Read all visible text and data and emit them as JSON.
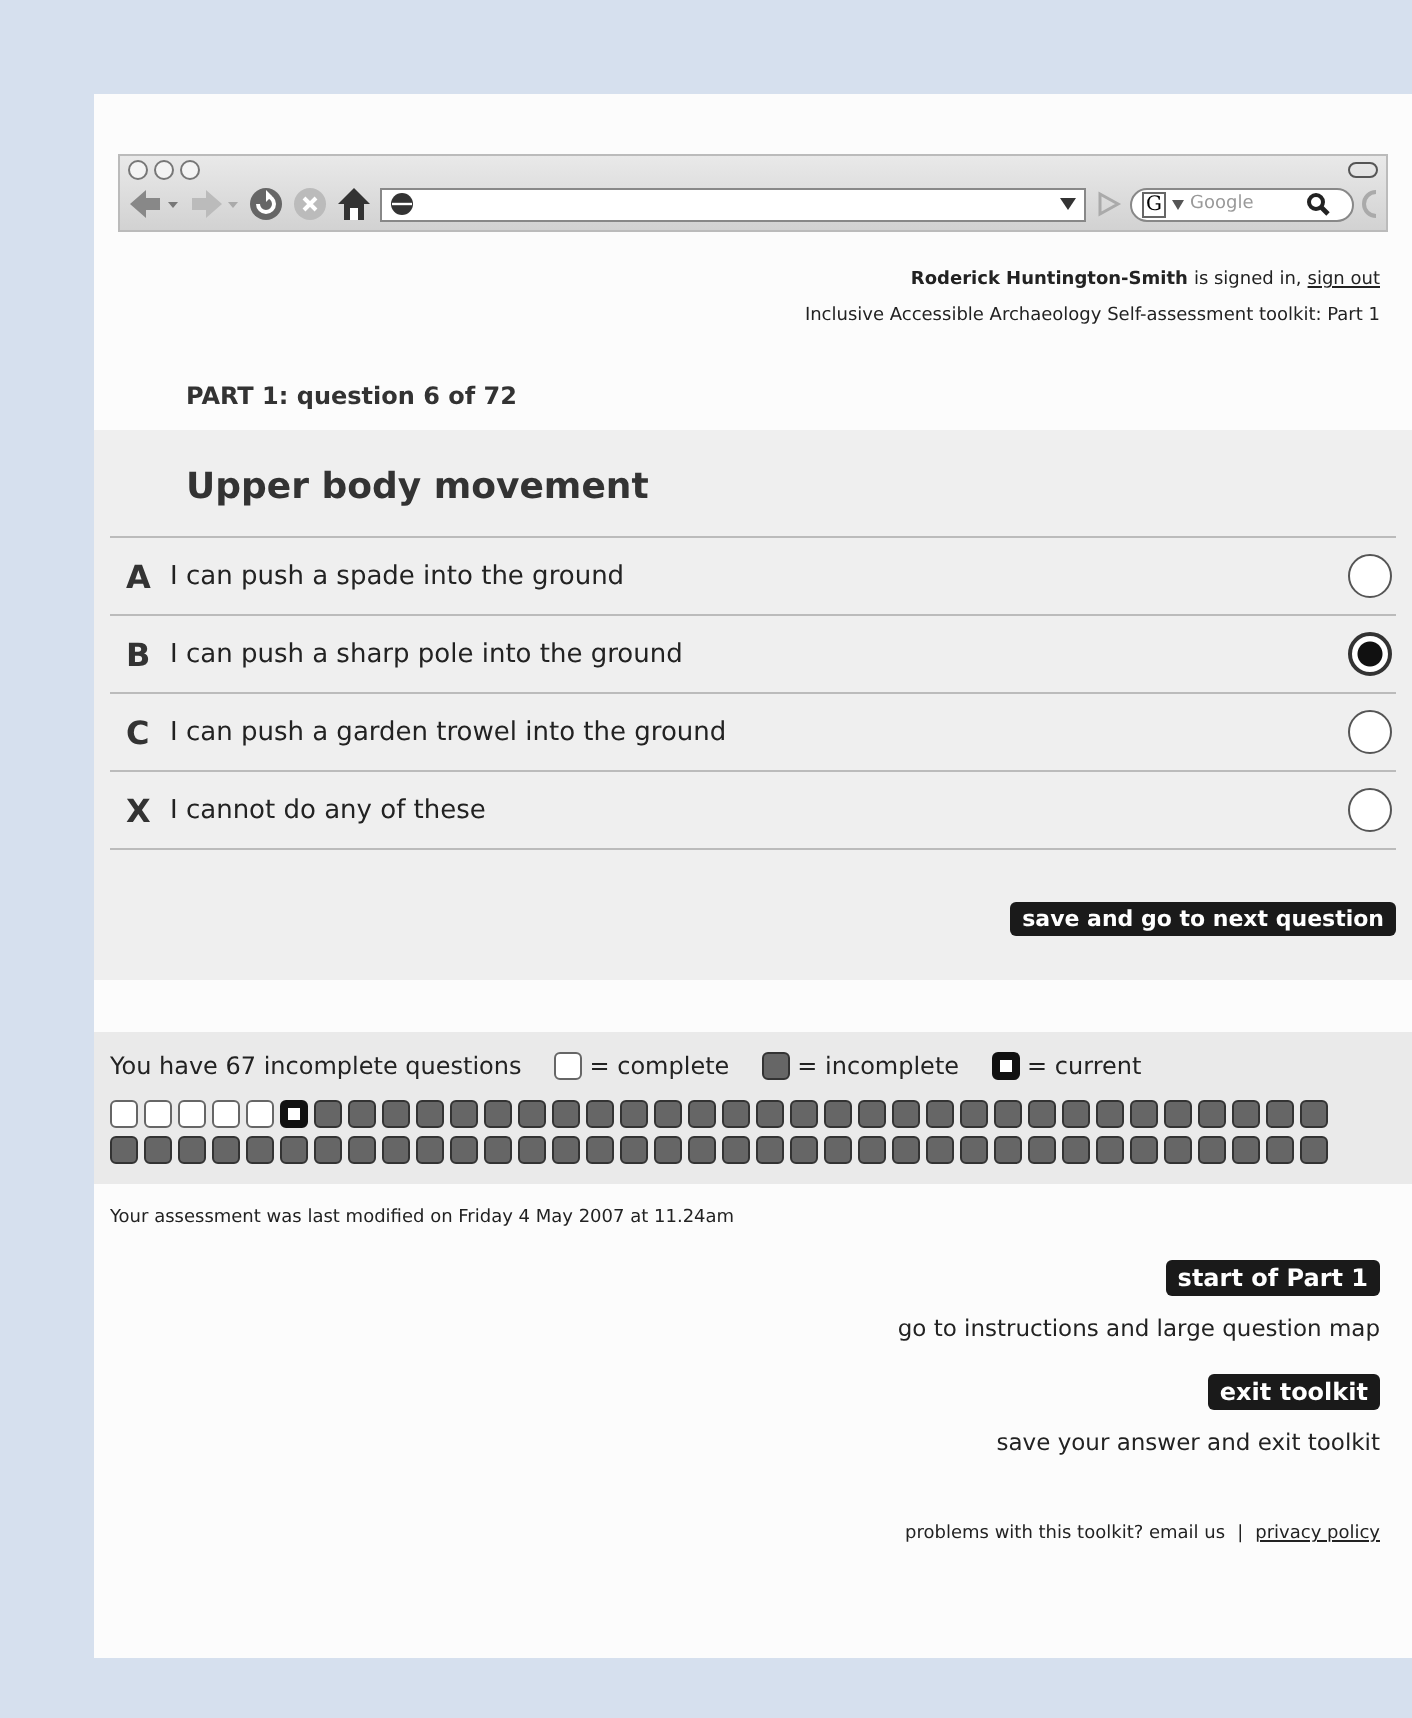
{
  "browser": {
    "search": {
      "engine": "G",
      "placeholder": "Google"
    }
  },
  "header": {
    "user": "Roderick Huntington-Smith",
    "signed_in_text": "is signed in,",
    "sign_out": "sign out",
    "toolkit_title": "Inclusive Accessible Archaeology Self-assessment toolkit: Part 1"
  },
  "progress": "PART 1: question 6 of 72",
  "question": {
    "title": "Upper body movement",
    "options": [
      {
        "letter": "A",
        "text": "I can push a spade into the ground",
        "selected": false
      },
      {
        "letter": "B",
        "text": "I can push a sharp pole into the ground",
        "selected": true
      },
      {
        "letter": "C",
        "text": "I can push a garden trowel into the ground",
        "selected": false
      },
      {
        "letter": "X",
        "text": "I cannot do any of these",
        "selected": false
      }
    ],
    "next_button": "save and go to next question"
  },
  "map": {
    "summary": "You have 67 incomplete questions",
    "legend": [
      {
        "kind": "complete",
        "label": "= complete"
      },
      {
        "kind": "incomplete",
        "label": "= incomplete"
      },
      {
        "kind": "current",
        "label": "= current"
      }
    ],
    "questions": [
      {
        "kind": "complete"
      },
      {
        "kind": "complete"
      },
      {
        "kind": "complete"
      },
      {
        "kind": "complete"
      },
      {
        "kind": "complete"
      },
      {
        "kind": "current"
      },
      {
        "kind": "incomplete"
      },
      {
        "kind": "incomplete"
      },
      {
        "kind": "incomplete"
      },
      {
        "kind": "incomplete"
      },
      {
        "kind": "incomplete"
      },
      {
        "kind": "incomplete"
      },
      {
        "kind": "incomplete"
      },
      {
        "kind": "incomplete"
      },
      {
        "kind": "incomplete"
      },
      {
        "kind": "incomplete"
      },
      {
        "kind": "incomplete"
      },
      {
        "kind": "incomplete"
      },
      {
        "kind": "incomplete"
      },
      {
        "kind": "incomplete"
      },
      {
        "kind": "incomplete"
      },
      {
        "kind": "incomplete"
      },
      {
        "kind": "incomplete"
      },
      {
        "kind": "incomplete"
      },
      {
        "kind": "incomplete"
      },
      {
        "kind": "incomplete"
      },
      {
        "kind": "incomplete"
      },
      {
        "kind": "incomplete"
      },
      {
        "kind": "incomplete"
      },
      {
        "kind": "incomplete"
      },
      {
        "kind": "incomplete"
      },
      {
        "kind": "incomplete"
      },
      {
        "kind": "incomplete"
      },
      {
        "kind": "incomplete"
      },
      {
        "kind": "incomplete"
      },
      {
        "kind": "incomplete"
      },
      {
        "kind": "incomplete"
      },
      {
        "kind": "incomplete"
      },
      {
        "kind": "incomplete"
      },
      {
        "kind": "incomplete"
      },
      {
        "kind": "incomplete"
      },
      {
        "kind": "incomplete"
      },
      {
        "kind": "incomplete"
      },
      {
        "kind": "incomplete"
      },
      {
        "kind": "incomplete"
      },
      {
        "kind": "incomplete"
      },
      {
        "kind": "incomplete"
      },
      {
        "kind": "incomplete"
      },
      {
        "kind": "incomplete"
      },
      {
        "kind": "incomplete"
      },
      {
        "kind": "incomplete"
      },
      {
        "kind": "incomplete"
      },
      {
        "kind": "incomplete"
      },
      {
        "kind": "incomplete"
      },
      {
        "kind": "incomplete"
      },
      {
        "kind": "incomplete"
      },
      {
        "kind": "incomplete"
      },
      {
        "kind": "incomplete"
      },
      {
        "kind": "incomplete"
      },
      {
        "kind": "incomplete"
      },
      {
        "kind": "incomplete"
      },
      {
        "kind": "incomplete"
      },
      {
        "kind": "incomplete"
      },
      {
        "kind": "incomplete"
      },
      {
        "kind": "incomplete"
      },
      {
        "kind": "incomplete"
      },
      {
        "kind": "incomplete"
      },
      {
        "kind": "incomplete"
      },
      {
        "kind": "incomplete"
      },
      {
        "kind": "incomplete"
      },
      {
        "kind": "incomplete"
      },
      {
        "kind": "incomplete"
      }
    ]
  },
  "modified": "Your assessment was last modified on Friday 4 May 2007 at 11.24am",
  "actions": [
    {
      "button": "start of Part 1",
      "description": "go to instructions and large question map"
    },
    {
      "button": "exit toolkit",
      "description": "save your answer and exit toolkit"
    }
  ],
  "footer": {
    "text": "problems with this toolkit? email us",
    "separator": "|",
    "link": "privacy policy"
  }
}
